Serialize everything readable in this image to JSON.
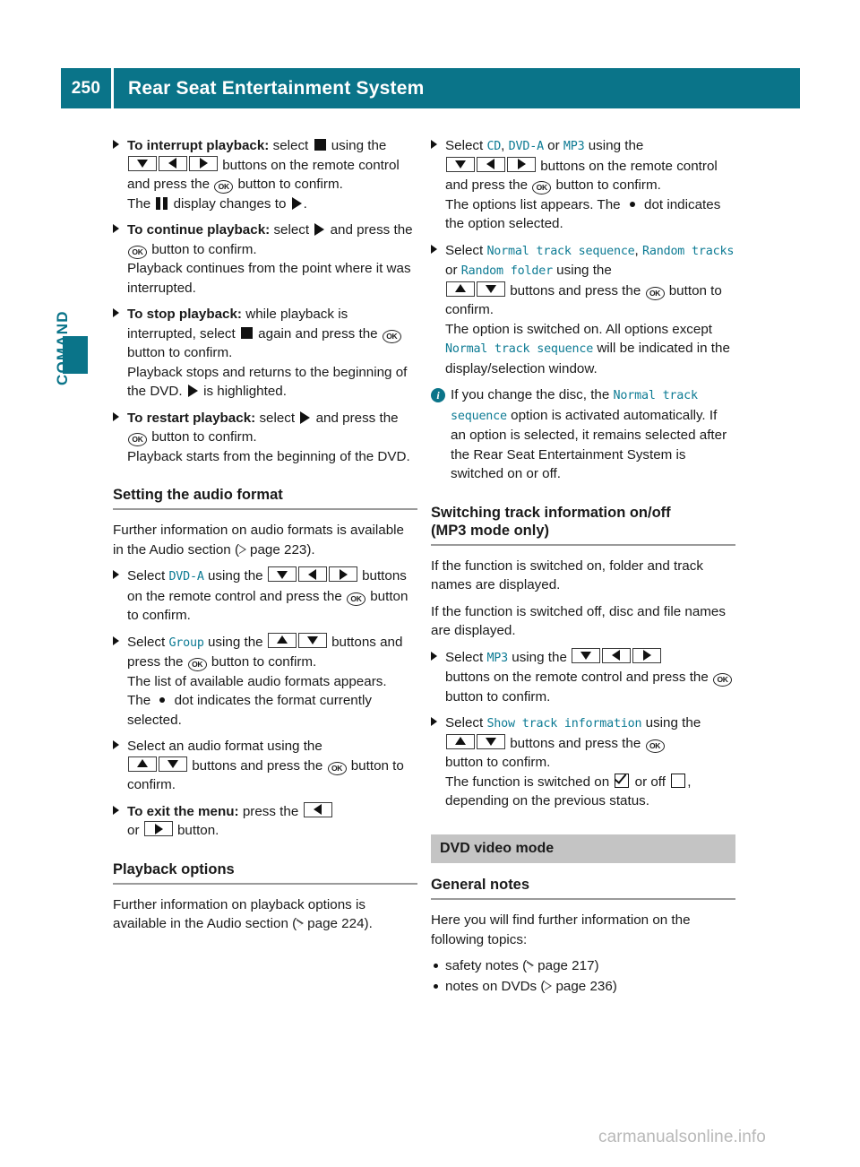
{
  "header": {
    "page_number": "250",
    "title": "Rear Seat Entertainment System",
    "accent_color": "#0a7489"
  },
  "side_tab": {
    "label": "COMAND",
    "color": "#0a7489"
  },
  "left_column": {
    "items": [
      {
        "type": "bullet",
        "lead": "To interrupt playback:",
        "t1": " select ",
        "t2": " using the ",
        "t3": " buttons on the remote control and press the ",
        "t4": " button to confirm.",
        "t5": "The ",
        "t6": " display changes to ",
        "t7": "."
      },
      {
        "type": "bullet",
        "lead": "To continue playback:",
        "t1": " select ",
        "t2": " and press the ",
        "t3": " button to confirm.",
        "t4": "Playback continues from the point where it was interrupted."
      },
      {
        "type": "bullet",
        "lead": "To stop playback:",
        "t1": " while playback is interrupted, select ",
        "t2": " again and press the ",
        "t3": " button to confirm.",
        "t4": "Playback stops and returns to the beginning of the DVD. ",
        "t5": " is highlighted."
      },
      {
        "type": "bullet",
        "lead": "To restart playback:",
        "t1": " select ",
        "t2": " and press the ",
        "t3": " button to confirm.",
        "t4": "Playback starts from the beginning of the DVD."
      }
    ],
    "heading_audio_format": "Setting the audio format",
    "audio_intro_a": "Further information on audio formats is available in the Audio section (",
    "audio_intro_ref": "page 223",
    "audio_intro_b": ").",
    "select_dvda": {
      "t1": "Select ",
      "ui": "DVD-A",
      "t2": " using the ",
      "t3": " buttons on the remote control and press the ",
      "t4": " button to confirm."
    },
    "select_group": {
      "t1": "Select ",
      "ui": "Group",
      "t2": " using the ",
      "t3": " buttons and press the ",
      "t4": " button to confirm.",
      "t5": "The list of available audio formats appears.",
      "t6": "The ",
      "t7": " dot indicates the format currently selected."
    },
    "select_format": {
      "t1": "Select an audio format using the ",
      "t2": " buttons and press the ",
      "t3": " button to confirm."
    },
    "exit_menu": {
      "lead": "To exit the menu:",
      "t1": " press the ",
      "t2": " or ",
      "t3": " button."
    },
    "heading_playback_options": "Playback options",
    "playback_intro_a": "Further information on playback options is available in the Audio section (",
    "playback_intro_ref": "page 224",
    "playback_intro_b": ")."
  },
  "right_column": {
    "select_source": {
      "t1": "Select ",
      "ui1": "CD",
      "sep1": ", ",
      "ui2": "DVD-A",
      "sep2": " or ",
      "ui3": "MP3",
      "t2": " using the ",
      "t3": " buttons on the remote control and press the ",
      "t4": " button to confirm.",
      "t5": "The options list appears. The ",
      "t6": " dot indicates the option selected."
    },
    "select_sequence": {
      "t1": "Select ",
      "ui1": "Normal track sequence",
      "sep1": ", ",
      "ui2": "Random tracks",
      "sep2": " or ",
      "ui3": "Random folder",
      "t2": " using the ",
      "t3": " buttons and press the ",
      "t4": " button to confirm.",
      "t5": "The option is switched on. All options except ",
      "ui4": "Normal track sequence",
      "t6": " will be indicated in the display/selection window."
    },
    "note": {
      "t1": "If you change the disc, the ",
      "ui1": "Normal track sequence",
      "t2": " option is activated automatically. If an option is selected, it remains selected after the Rear Seat Entertainment System is switched on or off."
    },
    "heading_track_info_l1": "Switching track information on/off",
    "heading_track_info_l2": "(MP3 mode only)",
    "track_on_text": "If the function is switched on, folder and track names are displayed.",
    "track_off_text": "If the function is switched off, disc and file names are displayed.",
    "select_mp3": {
      "t1": "Select ",
      "ui": "MP3",
      "t2": " using the ",
      "t3": " buttons on the remote control and press the ",
      "t4": " button to confirm."
    },
    "select_show_track": {
      "t1": "Select ",
      "ui": "Show track information",
      "t2": " using the ",
      "t3": " buttons and press the ",
      "t4": " button to confirm.",
      "t5": "The function is switched on ",
      "t6": " or off ",
      "t7": ", depending on the previous status."
    },
    "banner_dvd_video": "DVD video mode",
    "heading_general_notes": "General notes",
    "general_intro": "Here you will find further information on the following topics:",
    "topics": [
      {
        "text_a": "safety notes (",
        "ref": "page 217",
        "text_b": ")"
      },
      {
        "text_a": "notes on DVDs (",
        "ref": "page 236",
        "text_b": ")"
      }
    ]
  },
  "footer": {
    "watermark": "carmanualsonline.info"
  }
}
